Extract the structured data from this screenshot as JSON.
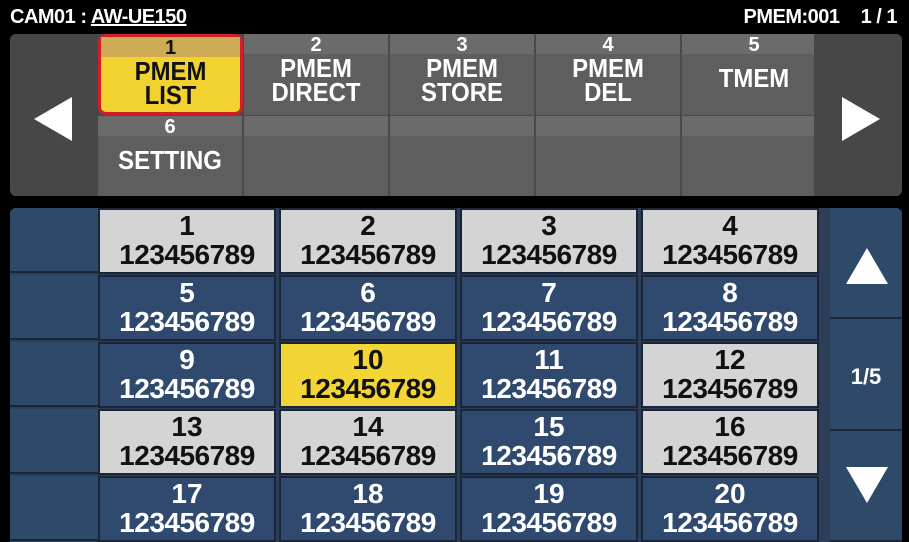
{
  "header": {
    "camera": "CAM01 :",
    "model": "AW-UE150",
    "pmem": "PMEM:001",
    "page": "1 / 1"
  },
  "menu": [
    {
      "num": "1",
      "label": "PMEM\nLIST",
      "selected": true
    },
    {
      "num": "2",
      "label": "PMEM\nDIRECT",
      "selected": false
    },
    {
      "num": "3",
      "label": "PMEM\nSTORE",
      "selected": false
    },
    {
      "num": "4",
      "label": "PMEM\nDEL",
      "selected": false
    },
    {
      "num": "5",
      "label": "TMEM",
      "selected": false
    },
    {
      "num": "6",
      "label": "SETTING",
      "selected": false
    },
    {
      "num": "",
      "label": "",
      "selected": false
    },
    {
      "num": "",
      "label": "",
      "selected": false
    },
    {
      "num": "",
      "label": "",
      "selected": false
    },
    {
      "num": "",
      "label": "",
      "selected": false
    }
  ],
  "pager": {
    "indicator": "1/5"
  },
  "presets": [
    {
      "num": "1",
      "value": "123456789",
      "style": "light"
    },
    {
      "num": "2",
      "value": "123456789",
      "style": "light"
    },
    {
      "num": "3",
      "value": "123456789",
      "style": "light"
    },
    {
      "num": "4",
      "value": "123456789",
      "style": "light"
    },
    {
      "num": "5",
      "value": "123456789",
      "style": "dark"
    },
    {
      "num": "6",
      "value": "123456789",
      "style": "dark"
    },
    {
      "num": "7",
      "value": "123456789",
      "style": "dark"
    },
    {
      "num": "8",
      "value": "123456789",
      "style": "dark"
    },
    {
      "num": "9",
      "value": "123456789",
      "style": "dark"
    },
    {
      "num": "10",
      "value": "123456789",
      "style": "yellow"
    },
    {
      "num": "11",
      "value": "123456789",
      "style": "dark"
    },
    {
      "num": "12",
      "value": "123456789",
      "style": "light"
    },
    {
      "num": "13",
      "value": "123456789",
      "style": "light"
    },
    {
      "num": "14",
      "value": "123456789",
      "style": "light"
    },
    {
      "num": "15",
      "value": "123456789",
      "style": "dark"
    },
    {
      "num": "16",
      "value": "123456789",
      "style": "light"
    },
    {
      "num": "17",
      "value": "123456789",
      "style": "dark"
    },
    {
      "num": "18",
      "value": "123456789",
      "style": "dark"
    },
    {
      "num": "19",
      "value": "123456789",
      "style": "dark"
    },
    {
      "num": "20",
      "value": "123456789",
      "style": "dark"
    }
  ],
  "colors": {
    "selected_fill": "#f2d22e",
    "selected_border": "#d21e28",
    "cell_light": "#d4d4d4",
    "cell_dark": "#2f4a6e",
    "cell_yellow": "#f3d535"
  }
}
